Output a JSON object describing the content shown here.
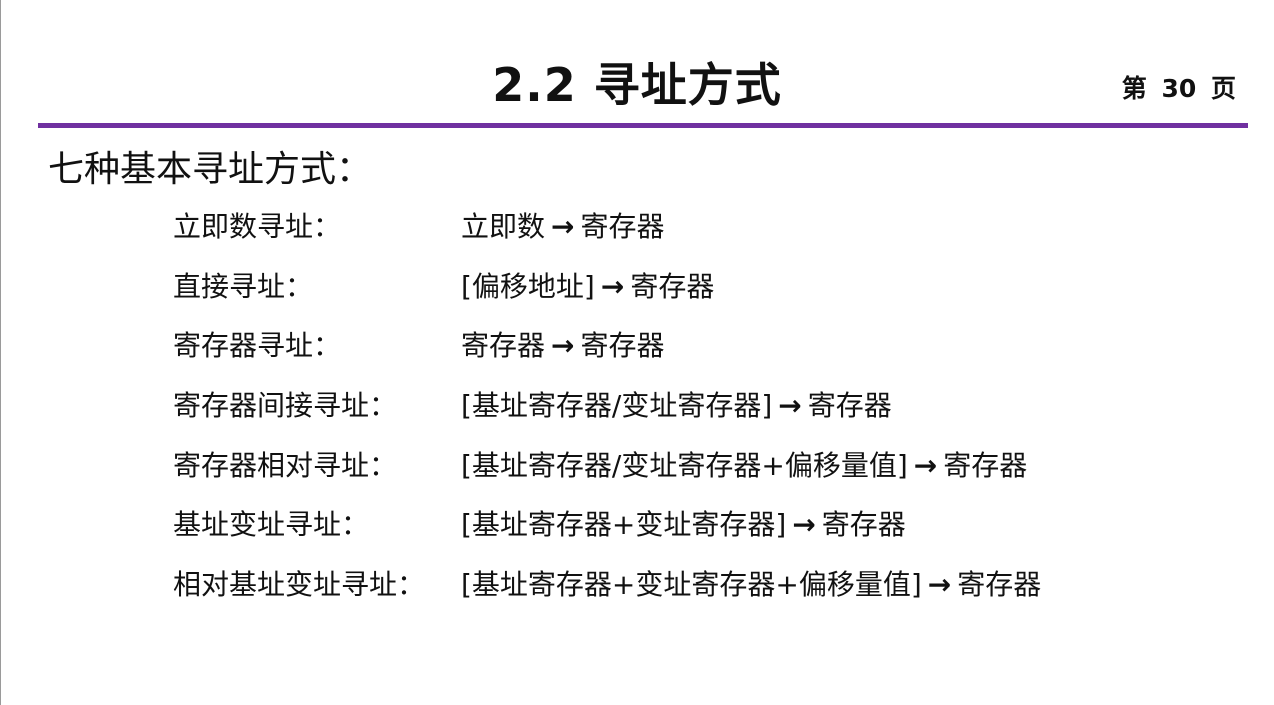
{
  "slide": {
    "title": "2.2 寻址方式",
    "page_number": "第 30 页",
    "accent_color": "#7030a0"
  },
  "section": {
    "heading": "七种基本寻址方式："
  },
  "modes": [
    {
      "name": "立即数寻址：",
      "source": "立即数",
      "arrow": "→",
      "target": "寄存器"
    },
    {
      "name": "直接寻址：",
      "source": "[偏移地址]",
      "arrow": "→",
      "target": "寄存器"
    },
    {
      "name": "寄存器寻址：",
      "source": "寄存器",
      "arrow": "→",
      "target": "寄存器"
    },
    {
      "name": "寄存器间接寻址：",
      "source": "[基址寄存器/变址寄存器]",
      "arrow": "→",
      "target": "寄存器"
    },
    {
      "name": "寄存器相对寻址：",
      "source": "[基址寄存器/变址寄存器+偏移量值]",
      "arrow": "→",
      "target": "寄存器"
    },
    {
      "name": "基址变址寻址：",
      "source": "[基址寄存器+变址寄存器]",
      "arrow": "→",
      "target": "寄存器"
    },
    {
      "name": "相对基址变址寻址：",
      "source": "[基址寄存器+变址寄存器+偏移量值]",
      "arrow": "→",
      "target": "寄存器"
    }
  ]
}
